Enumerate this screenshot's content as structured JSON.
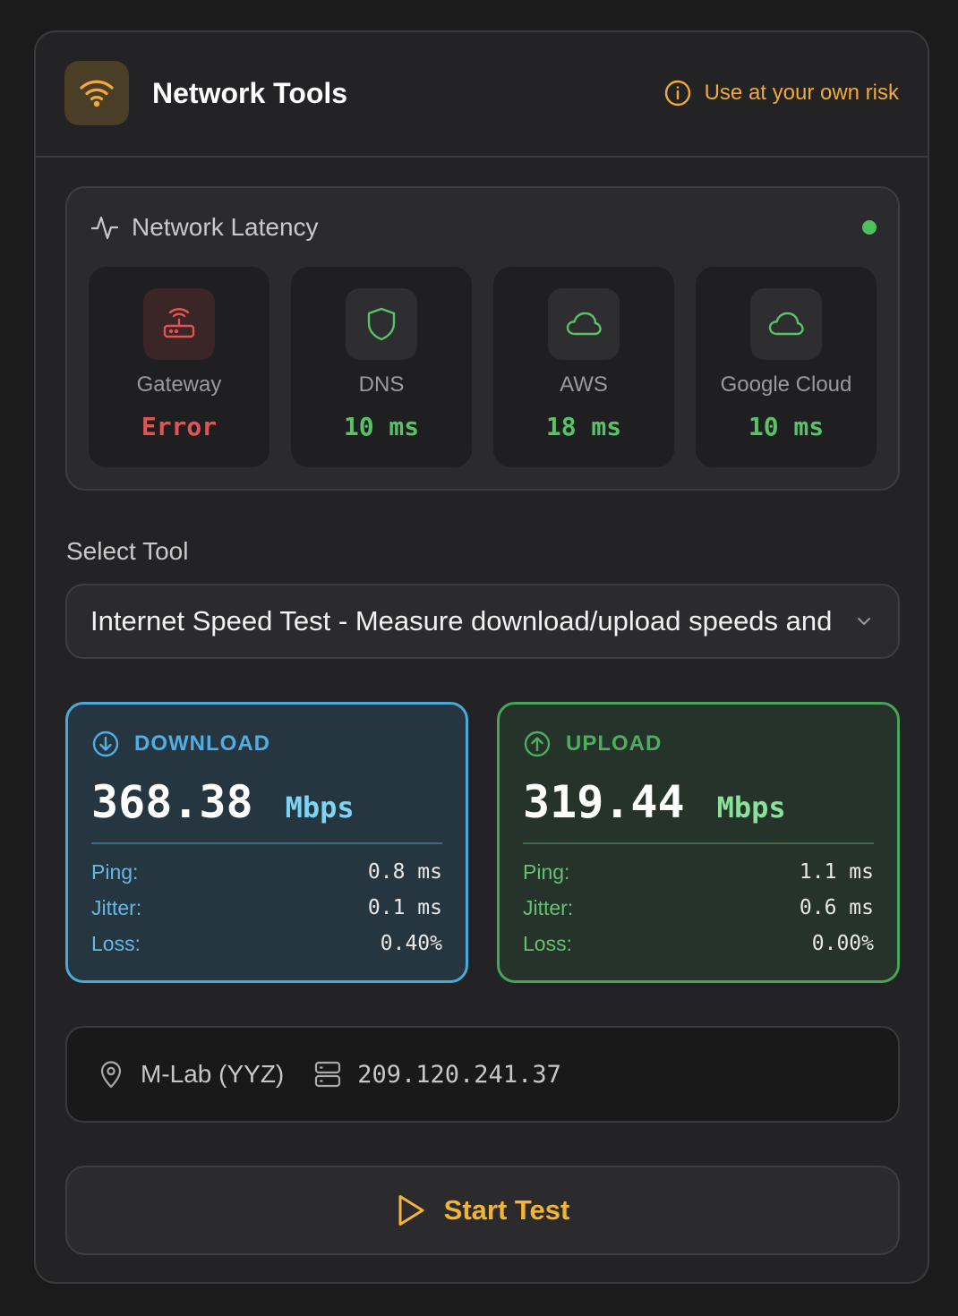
{
  "header": {
    "title": "Network Tools",
    "app_icon": "wifi-icon",
    "risk_icon": "info-icon",
    "risk_text": "Use at your own risk"
  },
  "latency": {
    "title": "Network Latency",
    "title_icon": "activity-icon",
    "status_color": "#4fbf5f",
    "tiles": [
      {
        "label": "Gateway",
        "value": "Error",
        "icon": "router-icon",
        "status": "error"
      },
      {
        "label": "DNS",
        "value": "10 ms",
        "icon": "shield-icon",
        "status": "ok"
      },
      {
        "label": "AWS",
        "value": "18 ms",
        "icon": "cloud-icon",
        "status": "ok"
      },
      {
        "label": "Google Cloud",
        "value": "10 ms",
        "icon": "cloud-icon",
        "status": "ok"
      }
    ]
  },
  "tool": {
    "label": "Select Tool",
    "selected": "Internet Speed Test - Measure download/upload speeds and"
  },
  "download": {
    "title": "DOWNLOAD",
    "value": "368.38",
    "unit": "Mbps",
    "stats": [
      {
        "label": "Ping:",
        "value": "0.8 ms"
      },
      {
        "label": "Jitter:",
        "value": "0.1 ms"
      },
      {
        "label": "Loss:",
        "value": "0.40%"
      }
    ]
  },
  "upload": {
    "title": "UPLOAD",
    "value": "319.44",
    "unit": "Mbps",
    "stats": [
      {
        "label": "Ping:",
        "value": "1.1 ms"
      },
      {
        "label": "Jitter:",
        "value": "0.6 ms"
      },
      {
        "label": "Loss:",
        "value": "0.00%"
      }
    ]
  },
  "server": {
    "location": "M-Lab (YYZ)",
    "ip": "209.120.241.37"
  },
  "actions": {
    "start_label": "Start Test"
  },
  "colors": {
    "accent": "#f2b437",
    "download": "#4aa9d6",
    "upload": "#47a557",
    "error": "#e05454",
    "ok": "#58c266"
  }
}
